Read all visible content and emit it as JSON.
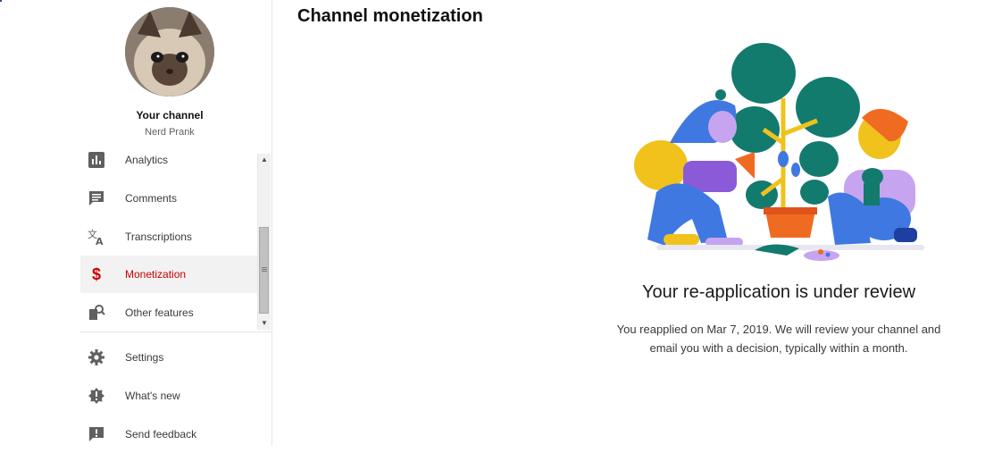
{
  "sidebar": {
    "channel_title": "Your channel",
    "channel_name": "Nerd Prank",
    "nav_items": [
      {
        "label": "Analytics",
        "icon": "analytics-icon"
      },
      {
        "label": "Comments",
        "icon": "comments-icon"
      },
      {
        "label": "Transcriptions",
        "icon": "translate-icon"
      },
      {
        "label": "Monetization",
        "icon": "dollar-icon",
        "active": true
      },
      {
        "label": "Other features",
        "icon": "other-features-icon"
      }
    ],
    "bottom_items": [
      {
        "label": "Settings",
        "icon": "gear-icon"
      },
      {
        "label": "What's new",
        "icon": "whats-new-icon"
      },
      {
        "label": "Send feedback",
        "icon": "feedback-icon"
      }
    ]
  },
  "main": {
    "title": "Channel monetization",
    "review_title": "Your re-application is under review",
    "review_line1": "You reapplied on Mar 7, 2019. We will review your channel and",
    "review_line2": "email you with a decision, typically within a month."
  },
  "colors": {
    "accent_red": "#cc0000",
    "leaf_green": "#137a6e",
    "figure_blue": "#3f78e0",
    "figure_yellow": "#f0c21b",
    "figure_purple": "#c7a4f0",
    "pot_orange": "#f06b22"
  }
}
